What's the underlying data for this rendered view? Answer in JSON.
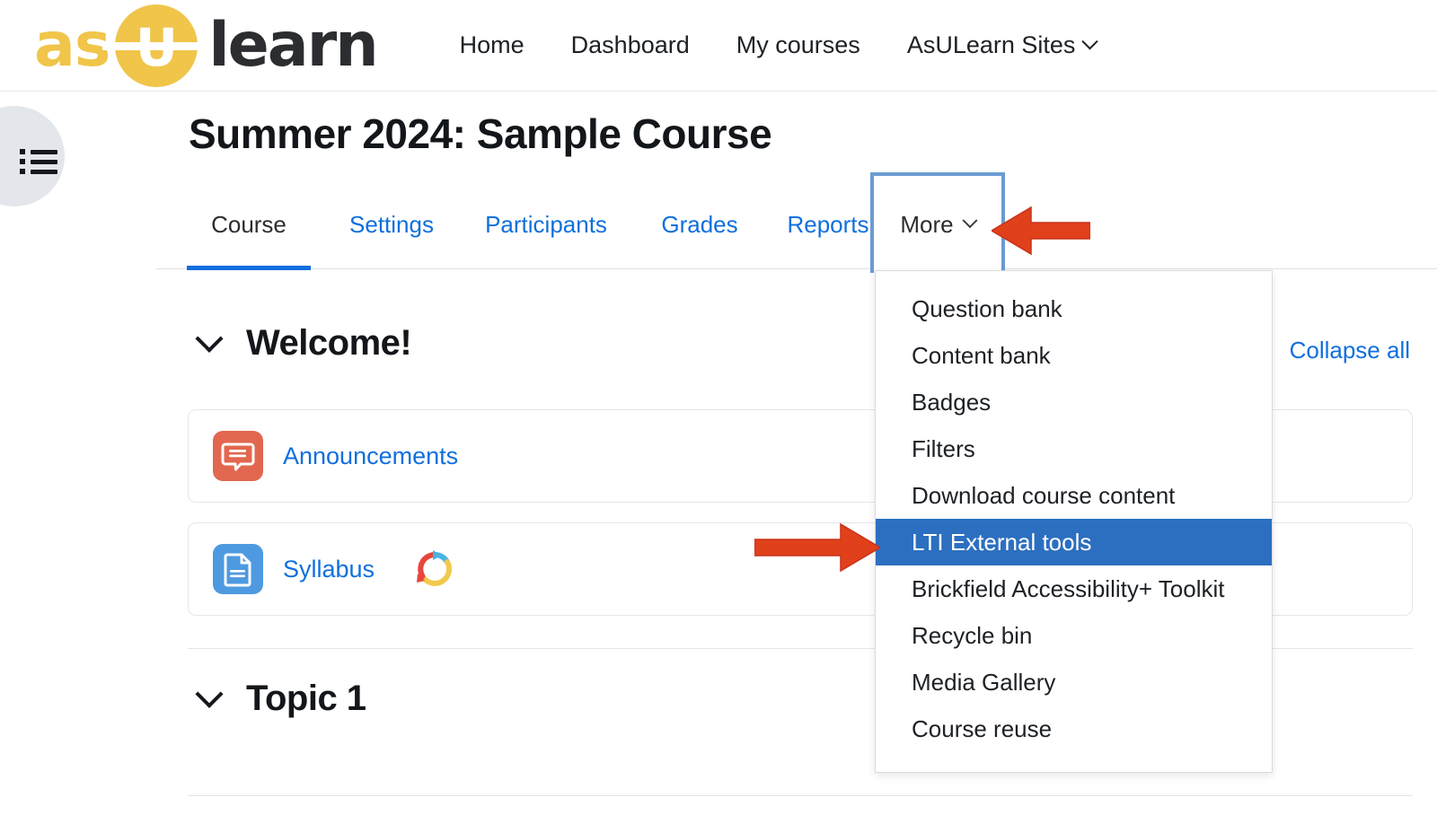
{
  "brand": {
    "text_as": "as",
    "text_u": "U",
    "text_learn": "learn",
    "color_yellow": "#f0c54a",
    "color_dark": "#2b2d30"
  },
  "navbar": {
    "links": [
      {
        "label": "Home",
        "has_caret": false
      },
      {
        "label": "Dashboard",
        "has_caret": false
      },
      {
        "label": "My courses",
        "has_caret": false
      },
      {
        "label": "AsULearn Sites",
        "has_caret": true
      }
    ]
  },
  "drawer": {
    "icon": "list-icon"
  },
  "page": {
    "title": "Summer 2024: Sample Course",
    "collapse_all": "Collapse all"
  },
  "tabs": [
    {
      "label": "Course",
      "active": true
    },
    {
      "label": "Settings",
      "active": false
    },
    {
      "label": "Participants",
      "active": false
    },
    {
      "label": "Grades",
      "active": false
    },
    {
      "label": "Reports",
      "active": false
    },
    {
      "label": "More",
      "active": false,
      "expanded": true
    }
  ],
  "more_menu": {
    "focus_border_color": "#6b9bd2",
    "selected_bg": "#2c6fc0",
    "items": [
      {
        "label": "Question bank",
        "selected": false
      },
      {
        "label": "Content bank",
        "selected": false
      },
      {
        "label": "Badges",
        "selected": false
      },
      {
        "label": "Filters",
        "selected": false
      },
      {
        "label": "Download course content",
        "selected": false
      },
      {
        "label": "LTI External tools",
        "selected": true
      },
      {
        "label": "Brickfield Accessibility+ Toolkit",
        "selected": false
      },
      {
        "label": "Recycle bin",
        "selected": false
      },
      {
        "label": "Media Gallery",
        "selected": false
      },
      {
        "label": "Course reuse",
        "selected": false
      }
    ]
  },
  "sections": [
    {
      "title": "Welcome!",
      "chevron": "chevron-down-icon"
    },
    {
      "title": "Topic 1",
      "chevron": "chevron-down-icon"
    }
  ],
  "activities": [
    {
      "name": "Announcements",
      "icon": "forum-icon",
      "icon_color": "#e1684f",
      "badge": null
    },
    {
      "name": "Syllabus",
      "icon": "page-icon",
      "icon_color": "#4e9ae0",
      "badge": "brickfield-accessibility-icon"
    }
  ],
  "annotations": {
    "arrow_color": "#e0401a",
    "arrows": [
      {
        "name": "arrow-pointing-to-more-tab",
        "direction": "left"
      },
      {
        "name": "arrow-pointing-to-lti-external-tools",
        "direction": "right"
      }
    ]
  }
}
